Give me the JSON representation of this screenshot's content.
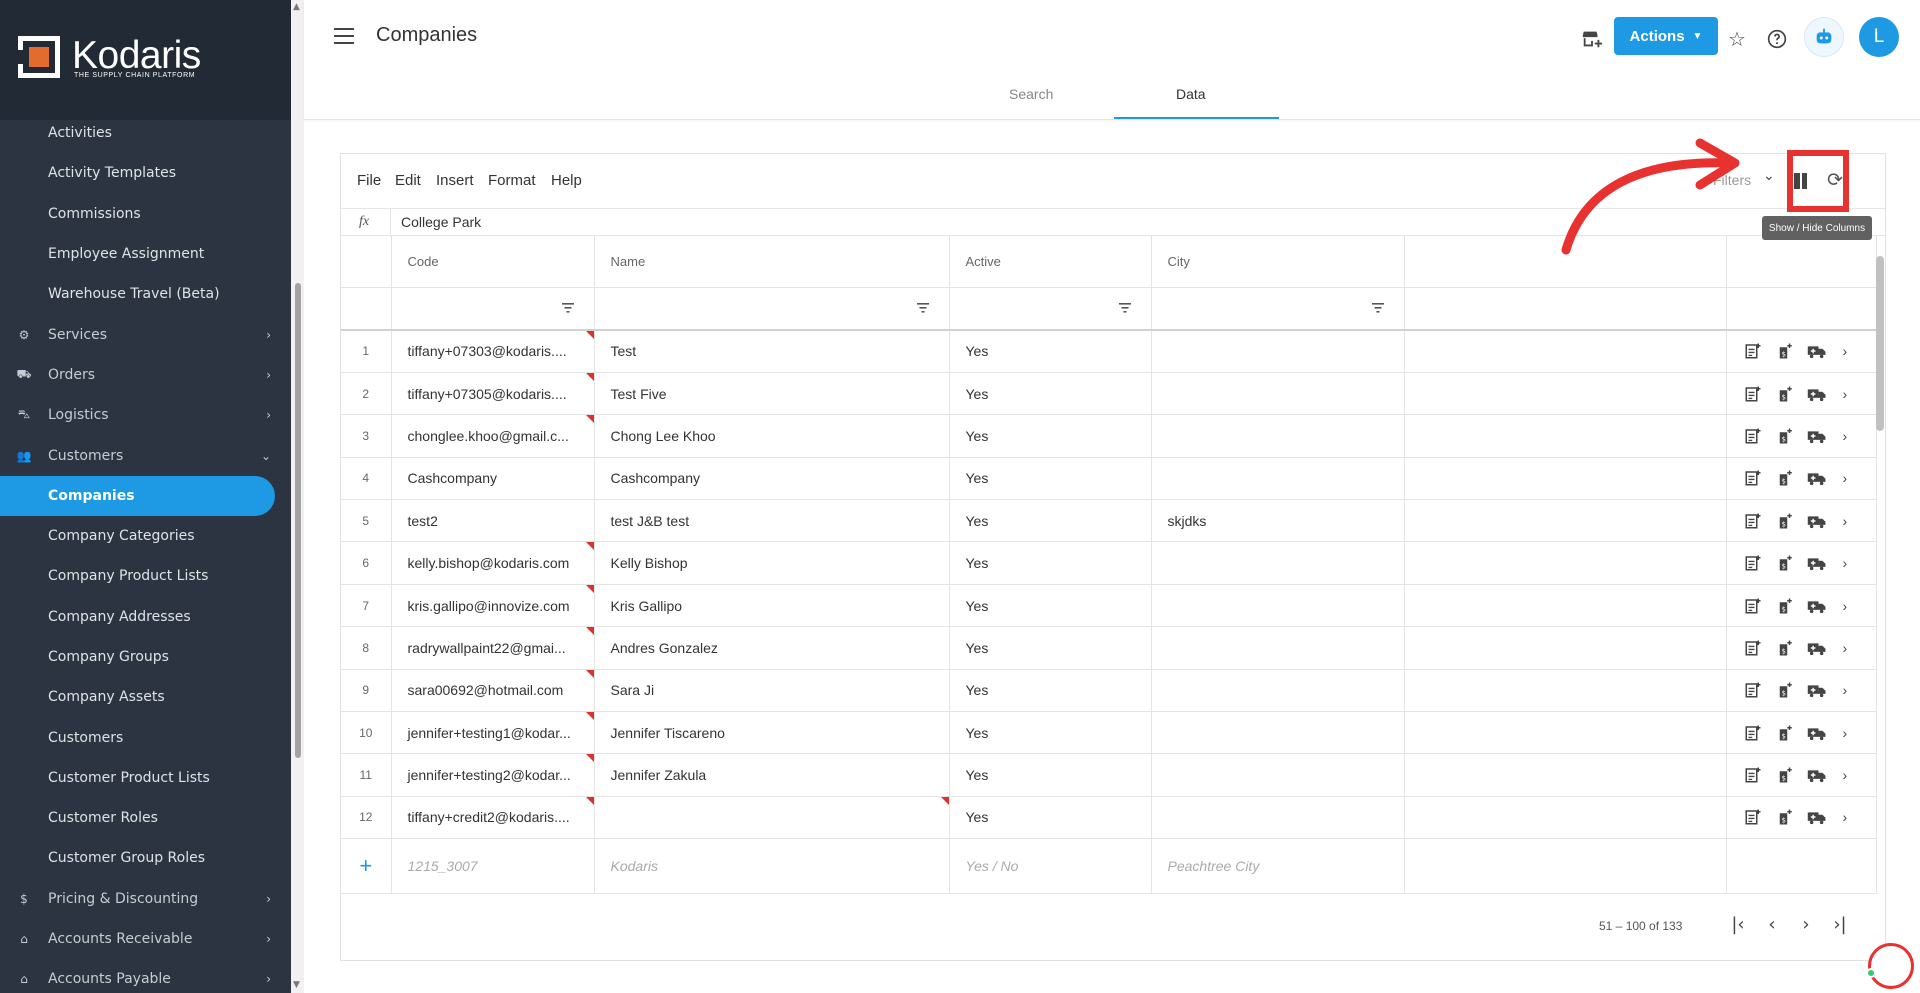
{
  "brand": {
    "name": "Kodaris",
    "tagline": "THE SUPPLY CHAIN PLATFORM"
  },
  "sidebar": {
    "items": [
      {
        "label": "Activities",
        "type": "sub"
      },
      {
        "label": "Activity Templates",
        "type": "sub"
      },
      {
        "label": "Commissions",
        "type": "sub"
      },
      {
        "label": "Employee Assignment",
        "type": "sub"
      },
      {
        "label": "Warehouse Travel (Beta)",
        "type": "sub"
      },
      {
        "label": "Services",
        "type": "group",
        "icon": "gears-icon",
        "chevron": "›"
      },
      {
        "label": "Orders",
        "type": "group",
        "icon": "truck-icon",
        "chevron": "›"
      },
      {
        "label": "Logistics",
        "type": "group",
        "icon": "car-icon",
        "chevron": "›"
      },
      {
        "label": "Customers",
        "type": "group",
        "icon": "people-icon",
        "chevron": "⌄"
      },
      {
        "label": "Companies",
        "type": "sub",
        "active": true
      },
      {
        "label": "Company Categories",
        "type": "sub"
      },
      {
        "label": "Company Product Lists",
        "type": "sub"
      },
      {
        "label": "Company Addresses",
        "type": "sub"
      },
      {
        "label": "Company Groups",
        "type": "sub"
      },
      {
        "label": "Company Assets",
        "type": "sub"
      },
      {
        "label": "Customers",
        "type": "sub"
      },
      {
        "label": "Customer Product Lists",
        "type": "sub"
      },
      {
        "label": "Customer Roles",
        "type": "sub"
      },
      {
        "label": "Customer Group Roles",
        "type": "sub"
      },
      {
        "label": "Pricing & Discounting",
        "type": "group",
        "icon": "dollar-icon",
        "chevron": "›"
      },
      {
        "label": "Accounts Receivable",
        "type": "group",
        "icon": "bank-icon",
        "chevron": "›"
      },
      {
        "label": "Accounts Payable",
        "type": "group",
        "icon": "bank-icon",
        "chevron": "›"
      }
    ]
  },
  "header": {
    "title": "Companies",
    "tabs": {
      "search": "Search",
      "data": "Data"
    },
    "actions_label": "Actions",
    "avatar_initial": "L"
  },
  "toolbar": {
    "menu": [
      "File",
      "Edit",
      "Insert",
      "Format",
      "Help"
    ],
    "filters_label": "Filters",
    "tooltip": "Show / Hide Columns"
  },
  "formula": {
    "label": "fx",
    "value": "College Park"
  },
  "grid": {
    "columns": [
      "Code",
      "Name",
      "Active",
      "City"
    ],
    "rows": [
      {
        "num": "1",
        "code": "tiffany+07303@kodaris....",
        "name": "Test",
        "active": "Yes",
        "city": "",
        "flag_code": true,
        "flag_name": false
      },
      {
        "num": "2",
        "code": "tiffany+07305@kodaris....",
        "name": "Test Five",
        "active": "Yes",
        "city": "",
        "flag_code": true,
        "flag_name": false
      },
      {
        "num": "3",
        "code": "chonglee.khoo@gmail.c...",
        "name": "Chong Lee Khoo",
        "active": "Yes",
        "city": "",
        "flag_code": true,
        "flag_name": false
      },
      {
        "num": "4",
        "code": "Cashcompany",
        "name": "Cashcompany",
        "active": "Yes",
        "city": "",
        "flag_code": false,
        "flag_name": false
      },
      {
        "num": "5",
        "code": "test2",
        "name": "test J&B test",
        "active": "Yes",
        "city": "skjdks",
        "flag_code": false,
        "flag_name": false
      },
      {
        "num": "6",
        "code": "kelly.bishop@kodaris.com",
        "name": "Kelly Bishop",
        "active": "Yes",
        "city": "",
        "flag_code": true,
        "flag_name": false
      },
      {
        "num": "7",
        "code": "kris.gallipo@innovize.com",
        "name": "Kris Gallipo",
        "active": "Yes",
        "city": "",
        "flag_code": true,
        "flag_name": false
      },
      {
        "num": "8",
        "code": "radrywallpaint22@gmai...",
        "name": "Andres Gonzalez",
        "active": "Yes",
        "city": "",
        "flag_code": true,
        "flag_name": false
      },
      {
        "num": "9",
        "code": "sara00692@hotmail.com",
        "name": "Sara Ji",
        "active": "Yes",
        "city": "",
        "flag_code": true,
        "flag_name": false
      },
      {
        "num": "10",
        "code": "jennifer+testing1@kodar...",
        "name": "Jennifer Tiscareno",
        "active": "Yes",
        "city": "",
        "flag_code": true,
        "flag_name": false
      },
      {
        "num": "11",
        "code": "jennifer+testing2@kodar...",
        "name": "Jennifer Zakula",
        "active": "Yes",
        "city": "",
        "flag_code": true,
        "flag_name": false
      },
      {
        "num": "12",
        "code": "tiffany+credit2@kodaris....",
        "name": "",
        "active": "Yes",
        "city": "",
        "flag_code": true,
        "flag_name": true
      }
    ],
    "new_row": {
      "plus": "+",
      "code": "1215_3007",
      "name": "Kodaris",
      "active": "Yes / No",
      "city": "Peachtree City"
    }
  },
  "pager": {
    "text": "51 – 100 of 133"
  },
  "colors": {
    "accent": "#1d9ae3",
    "sidebar_bg": "#2b3440",
    "annotation": "#e8322f"
  }
}
